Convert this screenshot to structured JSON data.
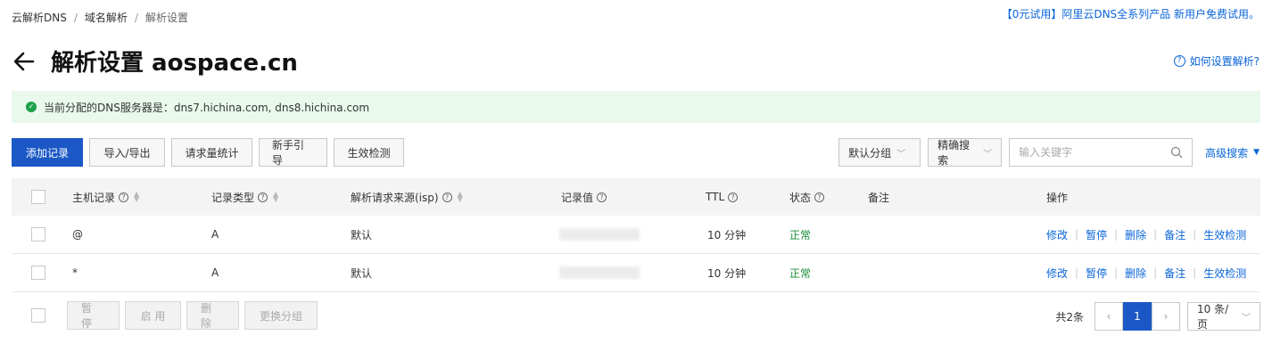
{
  "breadcrumb": {
    "items": [
      "云解析DNS",
      "域名解析",
      "解析设置"
    ]
  },
  "promo": "【0元试用】阿里云DNS全系列产品 新用户免费试用。",
  "page": {
    "title": "解析设置 aospace.cn",
    "help": "如何设置解析?"
  },
  "notice": {
    "text": "当前分配的DNS服务器是：dns7.hichina.com, dns8.hichina.com"
  },
  "toolbar": {
    "add": "添加记录",
    "import_export": "导入/导出",
    "stats": "请求量统计",
    "guide": "新手引导",
    "verify": "生效检测"
  },
  "filters": {
    "group": "默认分组",
    "search_mode": "精确搜索",
    "search_placeholder": "输入关键字",
    "advanced": "高级搜索"
  },
  "table": {
    "headers": {
      "host": "主机记录",
      "type": "记录类型",
      "isp": "解析请求来源(isp)",
      "value": "记录值",
      "ttl": "TTL",
      "status": "状态",
      "remark": "备注",
      "ops": "操作"
    },
    "rows": [
      {
        "host": "@",
        "type": "A",
        "isp": "默认",
        "ttl": "10 分钟",
        "status": "正常"
      },
      {
        "host": "*",
        "type": "A",
        "isp": "默认",
        "ttl": "10 分钟",
        "status": "正常"
      }
    ],
    "actions": [
      "修改",
      "暂停",
      "删除",
      "备注",
      "生效检测"
    ]
  },
  "bulk": {
    "pause": "暂 停",
    "enable": "启 用",
    "delete": "删 除",
    "change_group": "更换分组"
  },
  "pagination": {
    "total": "共2条",
    "current": "1",
    "page_size": "10 条/页"
  },
  "colors": {
    "primary": "#1b58c6",
    "link": "#0a65d8",
    "success": "#1a8f36",
    "notice_bg": "#e9f9ec"
  }
}
